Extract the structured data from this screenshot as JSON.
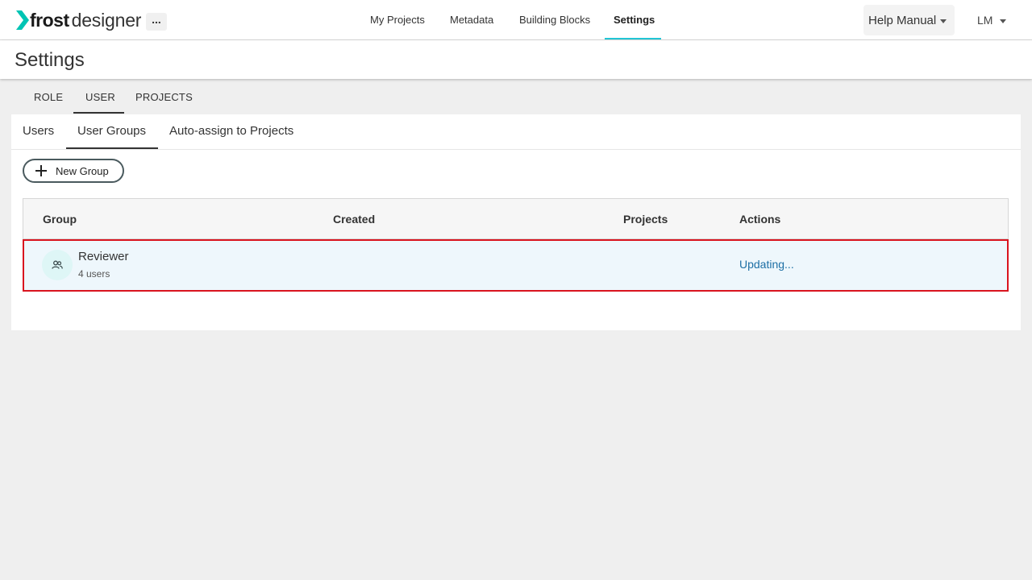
{
  "app": {
    "logo_frost": "frost",
    "logo_designer": "designer",
    "more_label": "...",
    "accent_color": "#22c7d6",
    "logo_chevron_color": "#00c4b4"
  },
  "nav": {
    "items": [
      {
        "label": "My Projects"
      },
      {
        "label": "Metadata"
      },
      {
        "label": "Building Blocks"
      },
      {
        "label": "Settings",
        "active": true
      }
    ],
    "help_label": "Help Manual",
    "user_initials": "LM"
  },
  "page": {
    "title": "Settings"
  },
  "tabs": [
    {
      "label": "ROLE"
    },
    {
      "label": "USER",
      "active": true
    },
    {
      "label": "PROJECTS"
    }
  ],
  "subtabs": [
    {
      "label": "Users"
    },
    {
      "label": "User Groups",
      "active": true
    },
    {
      "label": "Auto-assign to Projects"
    }
  ],
  "toolbar": {
    "new_group_label": "New Group"
  },
  "table": {
    "columns": [
      "Group",
      "Created",
      "Projects",
      "Actions"
    ],
    "rows": [
      {
        "name": "Reviewer",
        "subtitle": "4 users",
        "created": "",
        "projects": "",
        "action": "Updating...",
        "icon": "group-icon",
        "highlight_color": "#d9141f"
      }
    ]
  }
}
